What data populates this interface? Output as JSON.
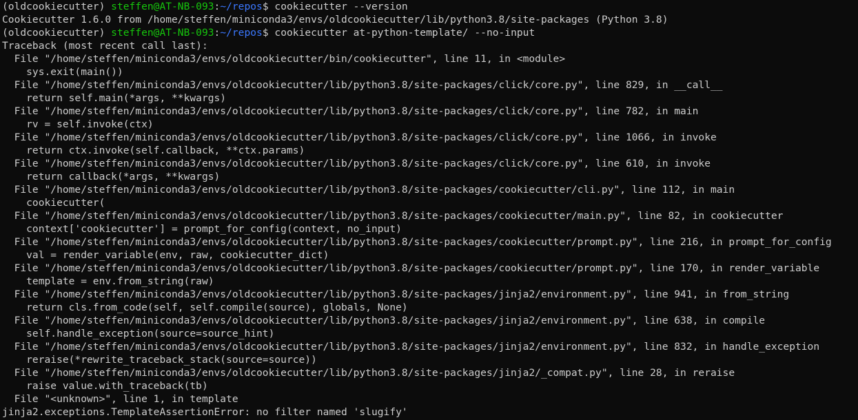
{
  "colors": {
    "background": "#0c0c0c",
    "text": "#cccccc",
    "user_host": "#16c60c",
    "path": "#3b78ff"
  },
  "prompt": {
    "env": "(oldcookiecutter) ",
    "user_host": "steffen@AT-NB-093",
    "colon": ":",
    "cwd": "~/repos",
    "dollar": "$ "
  },
  "commands": [
    "cookiecutter --version",
    "cookiecutter at-python-template/ --no-input"
  ],
  "version_output": "Cookiecutter 1.6.0 from /home/steffen/miniconda3/envs/oldcookiecutter/lib/python3.8/site-packages (Python 3.8)",
  "traceback_lines": [
    "Traceback (most recent call last):",
    "  File \"/home/steffen/miniconda3/envs/oldcookiecutter/bin/cookiecutter\", line 11, in <module>",
    "    sys.exit(main())",
    "  File \"/home/steffen/miniconda3/envs/oldcookiecutter/lib/python3.8/site-packages/click/core.py\", line 829, in __call__",
    "    return self.main(*args, **kwargs)",
    "  File \"/home/steffen/miniconda3/envs/oldcookiecutter/lib/python3.8/site-packages/click/core.py\", line 782, in main",
    "    rv = self.invoke(ctx)",
    "  File \"/home/steffen/miniconda3/envs/oldcookiecutter/lib/python3.8/site-packages/click/core.py\", line 1066, in invoke",
    "    return ctx.invoke(self.callback, **ctx.params)",
    "  File \"/home/steffen/miniconda3/envs/oldcookiecutter/lib/python3.8/site-packages/click/core.py\", line 610, in invoke",
    "    return callback(*args, **kwargs)",
    "  File \"/home/steffen/miniconda3/envs/oldcookiecutter/lib/python3.8/site-packages/cookiecutter/cli.py\", line 112, in main",
    "    cookiecutter(",
    "  File \"/home/steffen/miniconda3/envs/oldcookiecutter/lib/python3.8/site-packages/cookiecutter/main.py\", line 82, in cookiecutter",
    "    context['cookiecutter'] = prompt_for_config(context, no_input)",
    "  File \"/home/steffen/miniconda3/envs/oldcookiecutter/lib/python3.8/site-packages/cookiecutter/prompt.py\", line 216, in prompt_for_config",
    "    val = render_variable(env, raw, cookiecutter_dict)",
    "  File \"/home/steffen/miniconda3/envs/oldcookiecutter/lib/python3.8/site-packages/cookiecutter/prompt.py\", line 170, in render_variable",
    "    template = env.from_string(raw)",
    "  File \"/home/steffen/miniconda3/envs/oldcookiecutter/lib/python3.8/site-packages/jinja2/environment.py\", line 941, in from_string",
    "    return cls.from_code(self, self.compile(source), globals, None)",
    "  File \"/home/steffen/miniconda3/envs/oldcookiecutter/lib/python3.8/site-packages/jinja2/environment.py\", line 638, in compile",
    "    self.handle_exception(source=source_hint)",
    "  File \"/home/steffen/miniconda3/envs/oldcookiecutter/lib/python3.8/site-packages/jinja2/environment.py\", line 832, in handle_exception",
    "    reraise(*rewrite_traceback_stack(source=source))",
    "  File \"/home/steffen/miniconda3/envs/oldcookiecutter/lib/python3.8/site-packages/jinja2/_compat.py\", line 28, in reraise",
    "    raise value.with_traceback(tb)",
    "  File \"<unknown>\", line 1, in template",
    "jinja2.exceptions.TemplateAssertionError: no filter named 'slugify'"
  ]
}
